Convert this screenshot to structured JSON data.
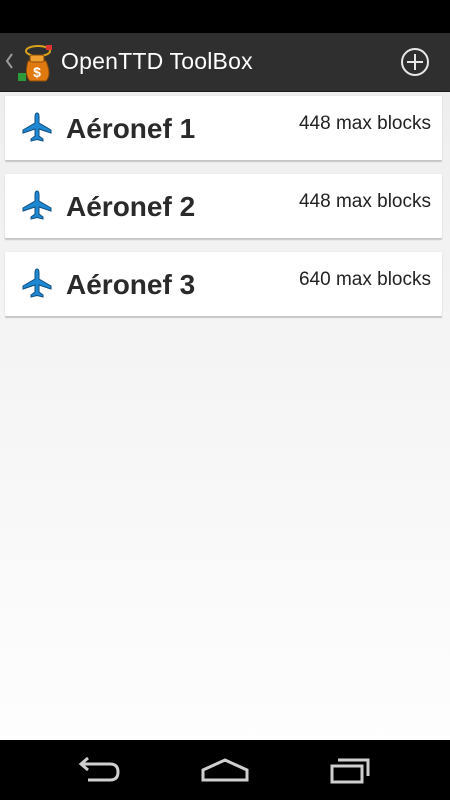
{
  "app": {
    "title": "OpenTTD ToolBox",
    "action_bar_color": "#2f2f2f",
    "accent_color": "#1e88d2"
  },
  "icons": {
    "up": "chevron-left-icon",
    "app": "money-bag-app-icon",
    "add": "plus-circle-icon",
    "aircraft": "airplane-icon",
    "back": "back-icon",
    "home": "home-icon",
    "recents": "recents-icon"
  },
  "items": [
    {
      "name": "Aéronef 1",
      "blocks": "448 max blocks"
    },
    {
      "name": "Aéronef 2",
      "blocks": "448 max blocks"
    },
    {
      "name": "Aéronef 3",
      "blocks": "640 max blocks"
    }
  ]
}
